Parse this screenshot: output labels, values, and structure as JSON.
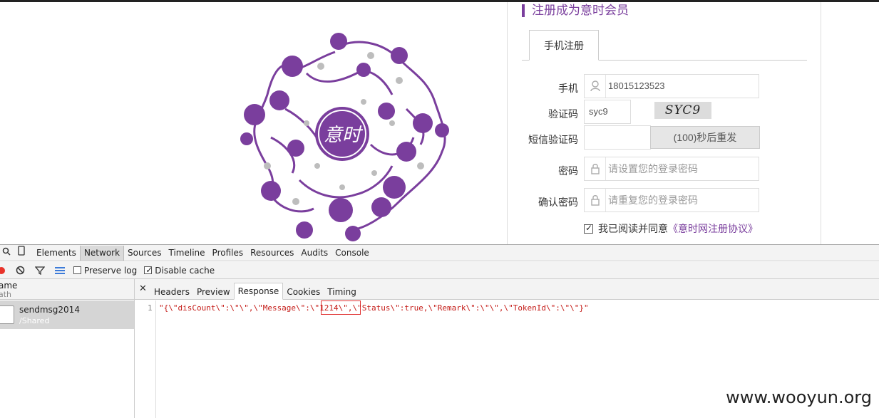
{
  "register": {
    "title": "注册成为意时会员",
    "tab": "手机注册",
    "phone_label": "手机",
    "phone_value": "18015123523",
    "captcha_label": "验证码",
    "captcha_value": "syc9",
    "captcha_image_text": "SYC9",
    "sms_label": "短信验证码",
    "sms_button": "(100)秒后重发",
    "password_label": "密码",
    "password_placeholder": "请设置您的登录密码",
    "confirm_label": "确认密码",
    "confirm_placeholder": "请重复您的登录密码",
    "agree_text": "我已阅读并同意",
    "agree_link": "《意时网注册协议》",
    "accent_color": "#7a3e9d"
  },
  "devtools": {
    "tabs": [
      "Elements",
      "Network",
      "Sources",
      "Timeline",
      "Profiles",
      "Resources",
      "Audits",
      "Console"
    ],
    "preserve_log": "Preserve log",
    "disable_cache": "Disable cache",
    "sidebar_head_name": "ame",
    "sidebar_head_path": "ath",
    "request_name": "sendmsg2014",
    "request_path": "/Shared",
    "detail_tabs": [
      "Headers",
      "Preview",
      "Response",
      "Cookies",
      "Timing"
    ],
    "line_number": "1",
    "response_text": "\"{\\\"disCount\\\":\\\"\\\",\\\"Message\\\":\\\"1214\\\",\\\"Status\\\":true,\\\"Remark\\\":\\\"\\\",\\\"TokenId\\\":\\\"\\\"}\""
  },
  "watermark": "www.wooyun.org"
}
